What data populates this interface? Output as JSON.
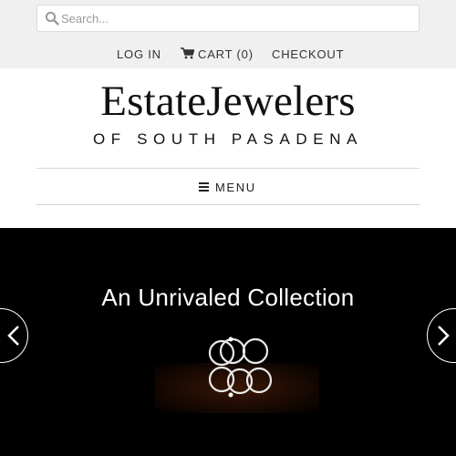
{
  "search": {
    "placeholder": "Search...",
    "icon": "search-icon"
  },
  "top_links": {
    "login": "LOG IN",
    "cart": "CART (0)",
    "checkout": "CHECKOUT"
  },
  "logo": {
    "name": "EstateJewelers",
    "subtitle": "OF SOUTH PASADENA"
  },
  "menu": {
    "label": "MENU",
    "icon": "hamburger-icon"
  },
  "hero": {
    "title": "An Unrivaled Collection",
    "prev_icon": "chevron-left-icon",
    "next_icon": "chevron-right-icon"
  },
  "colors": {
    "topbar_bg": "#f0f0f0",
    "hero_bg": "#000000",
    "text": "#333333"
  }
}
